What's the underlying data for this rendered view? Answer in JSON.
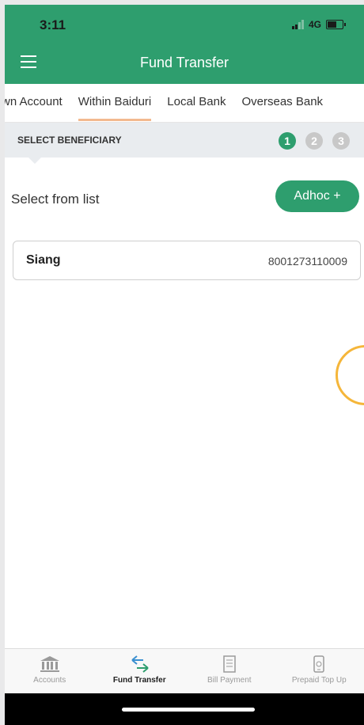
{
  "status": {
    "time": "3:11",
    "network": "4G"
  },
  "appbar": {
    "title": "Fund Transfer"
  },
  "tabs": [
    {
      "label": "wn Account"
    },
    {
      "label": "Within Baiduri"
    },
    {
      "label": "Local Bank"
    },
    {
      "label": "Overseas Bank"
    }
  ],
  "step_header": {
    "label": "SELECT BENEFICIARY",
    "steps": [
      "1",
      "2",
      "3"
    ],
    "active_step": 1
  },
  "select": {
    "label": "Select from list",
    "adhoc_label": "Adhoc +"
  },
  "beneficiaries": [
    {
      "name": "Siang",
      "account": "8001273110009"
    }
  ],
  "bottom_nav": [
    {
      "label": "Accounts",
      "icon": "bank-icon"
    },
    {
      "label": "Fund Transfer",
      "icon": "transfer-arrows-icon"
    },
    {
      "label": "Bill Payment",
      "icon": "bill-document-icon"
    },
    {
      "label": "Prepaid Top Up",
      "icon": "phone-topup-icon"
    }
  ],
  "colors": {
    "brand_green": "#2e9e6e",
    "active_tab_underline": "#f3b98f",
    "step_inactive": "#c8c8c8",
    "ring": "#f5b63a"
  }
}
